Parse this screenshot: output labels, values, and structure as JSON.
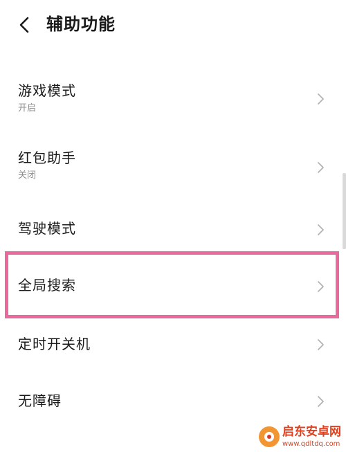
{
  "header": {
    "back_icon": "chevron-left-icon",
    "title": "辅助功能"
  },
  "settings": {
    "items": [
      {
        "label": "游戏模式",
        "status": "开启",
        "icon": "chevron-right-icon"
      },
      {
        "label": "红包助手",
        "status": "关闭",
        "icon": "chevron-right-icon"
      },
      {
        "label": "驾驶模式",
        "icon": "chevron-right-icon"
      },
      {
        "label": "全局搜索",
        "icon": "chevron-right-icon",
        "highlighted": true
      },
      {
        "label": "定时开关机",
        "icon": "chevron-right-icon"
      },
      {
        "label": "无障碍",
        "icon": "chevron-right-icon"
      }
    ]
  },
  "watermark": {
    "name": "启东安卓网",
    "url": "www.qdltdq.com"
  },
  "colors": {
    "highlight_border": "#e8699b",
    "secondary_text": "#8c8c8c",
    "chevron": "#b3b3b3",
    "watermark_text": "#e0401f"
  }
}
